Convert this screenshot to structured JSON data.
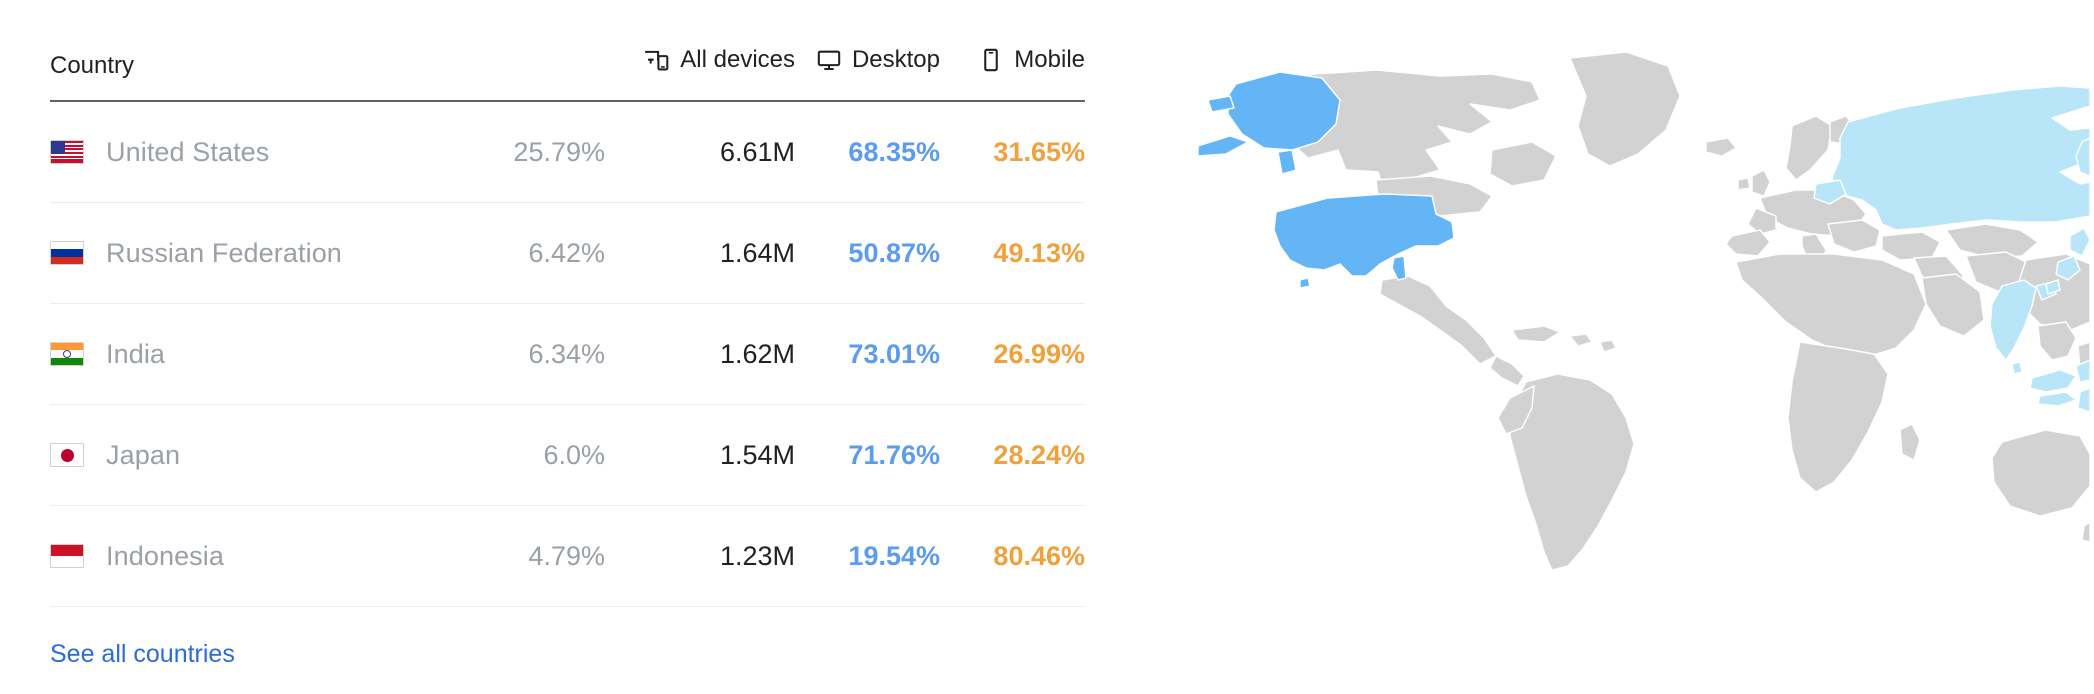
{
  "table": {
    "columns": [
      {
        "key": "country",
        "label": "Country",
        "icon": null
      },
      {
        "key": "share",
        "label": "",
        "icon": null
      },
      {
        "key": "all",
        "label": "All devices",
        "icon": "all-devices-icon"
      },
      {
        "key": "desktop",
        "label": "Desktop",
        "icon": "desktop-icon"
      },
      {
        "key": "mobile",
        "label": "Mobile",
        "icon": "mobile-icon"
      }
    ],
    "rows": [
      {
        "flag": "flag-us",
        "country": "United States",
        "share": "25.79%",
        "all_devices": "6.61M",
        "desktop": "68.35%",
        "mobile": "31.65%"
      },
      {
        "flag": "flag-ru",
        "country": "Russian Federation",
        "share": "6.42%",
        "all_devices": "1.64M",
        "desktop": "50.87%",
        "mobile": "49.13%"
      },
      {
        "flag": "flag-in",
        "country": "India",
        "share": "6.34%",
        "all_devices": "1.62M",
        "desktop": "73.01%",
        "mobile": "26.99%"
      },
      {
        "flag": "flag-jp",
        "country": "Japan",
        "share": "6.0%",
        "all_devices": "1.54M",
        "desktop": "71.76%",
        "mobile": "28.24%"
      },
      {
        "flag": "flag-id",
        "country": "Indonesia",
        "share": "4.79%",
        "all_devices": "1.23M",
        "desktop": "19.54%",
        "mobile": "80.46%"
      }
    ]
  },
  "footer": {
    "see_all_label": "See all countries"
  },
  "map": {
    "highlighted_primary": [
      "United States"
    ],
    "highlighted_secondary": [
      "Russian Federation",
      "India",
      "Japan",
      "Indonesia"
    ]
  },
  "colors": {
    "desktop_value": "#5b9bf0",
    "mobile_value": "#f0a03c",
    "country_text": "#9aa0a6",
    "all_devices_text": "#202124",
    "link": "#2b6cd4",
    "map_base": "#d2d2d2",
    "map_highlight_primary": "#64b5f6",
    "map_highlight_secondary": "#b8e6f8",
    "header_rule": "#5f6368",
    "row_rule": "#ededed"
  }
}
